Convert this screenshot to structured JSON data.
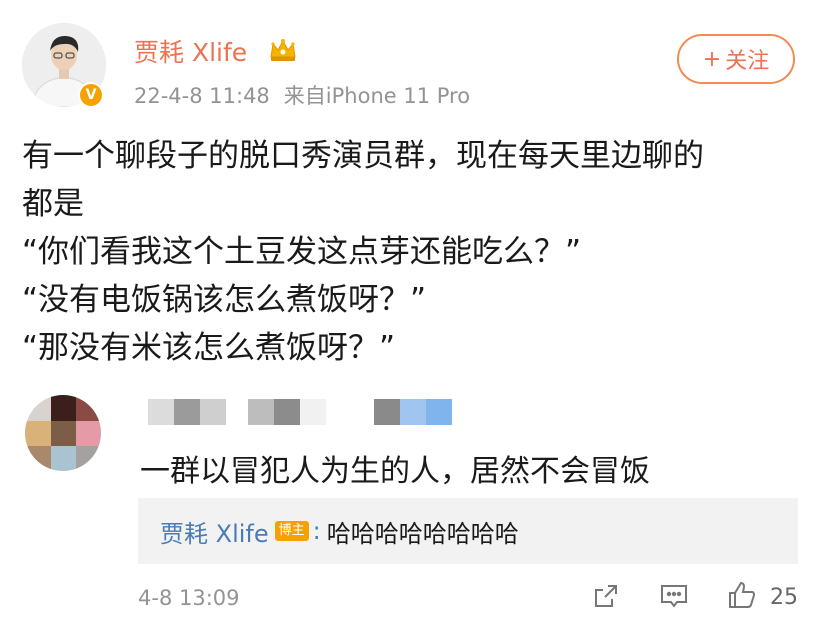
{
  "post": {
    "author": "贾耗 Xlife",
    "time": "22-4-8 11:48",
    "source": "来自iPhone 11 Pro",
    "follow_label": "关注",
    "follow_plus": "+",
    "verified_badge": "V",
    "text_lines": [
      "有一个聊段子的脱口秀演员群，现在每天里边聊的",
      "都是",
      "“你们看我这个土豆发这点芽还能吃么？”",
      "“没有电饭锅该怎么煮饭呀？”",
      "“那没有米该怎么煮饭呀？”"
    ]
  },
  "comment": {
    "text": "一群以冒犯人为生的人，居然不会冒饭",
    "time": "4-8 13:09",
    "like_count": "25",
    "reply": {
      "author": "贾耗 Xlife",
      "badge": "博主",
      "separator": ":",
      "text": "哈哈哈哈哈哈哈哈"
    }
  },
  "colors": {
    "accent": "#eb7350",
    "link_blue": "#4a7bb8",
    "meta_gray": "#939393",
    "reply_bg": "#f2f2f2",
    "badge_gold": "#f5a200"
  },
  "icons": [
    "crown-icon",
    "verified-badge-icon",
    "share-icon",
    "comment-icon",
    "like-icon"
  ]
}
